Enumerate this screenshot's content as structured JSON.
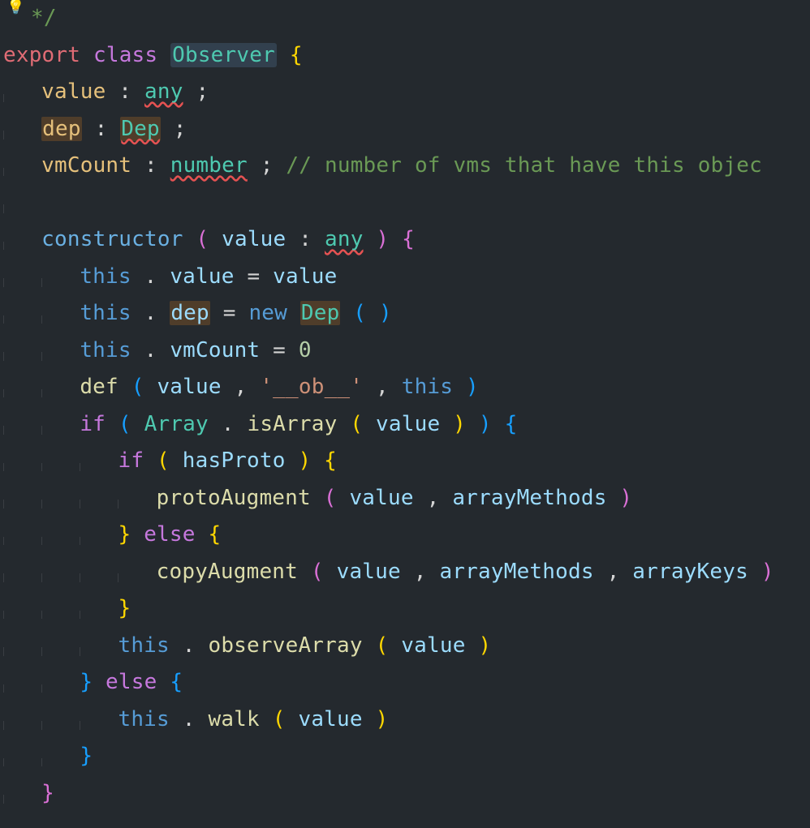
{
  "topCommentClose": "*/",
  "kw_export": "export",
  "kw_class": "class",
  "class_name": "Observer",
  "brace_open": "{",
  "prop_value": "value",
  "colon": ":",
  "type_any": "any",
  "semi": ";",
  "prop_dep": "dep",
  "type_Dep": "Dep",
  "prop_vmCount": "vmCount",
  "type_number": "number",
  "comment_vmcount": "// number of vms that have this objec",
  "ctor": "constructor",
  "paren_open": "(",
  "paren_close": ")",
  "param_value": "value",
  "kw_this": "this",
  "dot": ".",
  "eq": "=",
  "word_value": "value",
  "word_dep": "dep",
  "kw_new": "new",
  "new_Dep": "Dep",
  "word_vmCount": "vmCount",
  "lit_0": "0",
  "fn_def": "def",
  "comma": ",",
  "str_ob": "'__ob__'",
  "kw_if": "if",
  "obj_Array": "Array",
  "fn_isArray": "isArray",
  "var_hasProto": "hasProto",
  "fn_protoAugment": "protoAugment",
  "var_arrayMethods": "arrayMethods",
  "brace_close": "}",
  "kw_else": "else",
  "fn_copyAugment": "copyAugment",
  "var_arrayKeys": "arrayKeys",
  "fn_observeArray": "observeArray",
  "fn_walk": "walk"
}
